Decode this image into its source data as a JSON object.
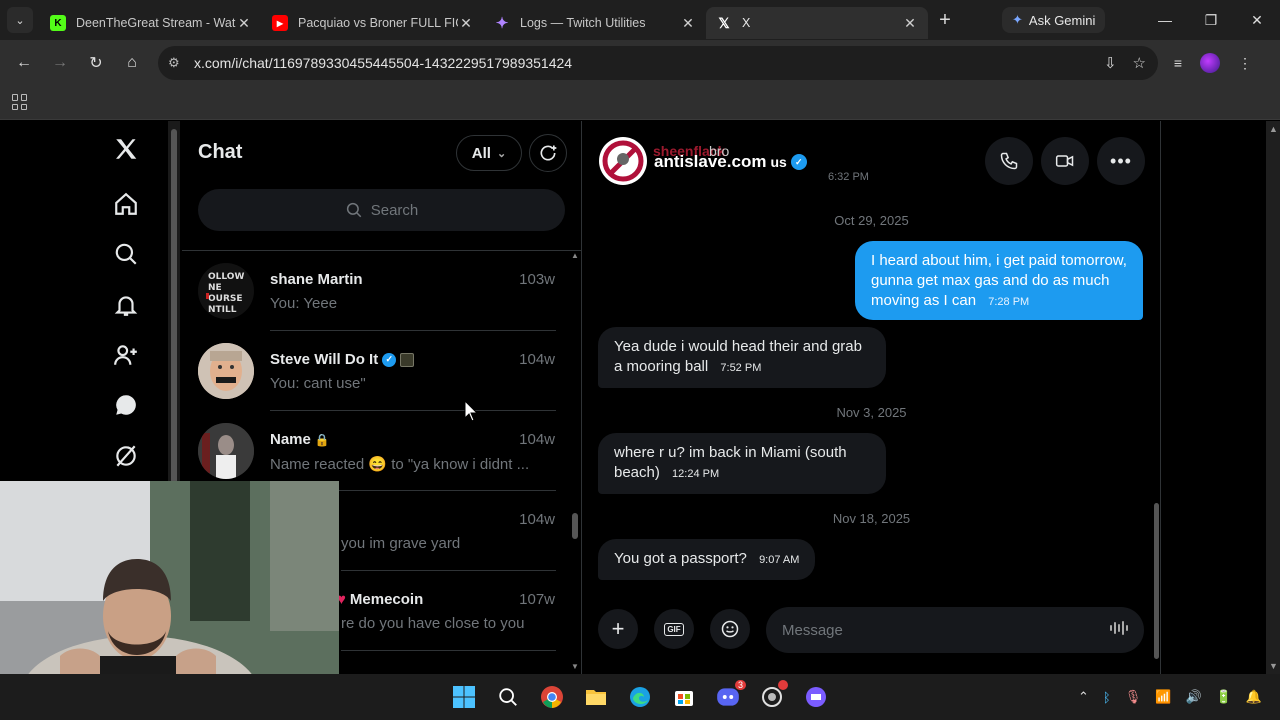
{
  "browser": {
    "tabs": [
      {
        "title": "DeenTheGreat Stream - Wat",
        "favicon": "kick-icon",
        "color": "#53fc18"
      },
      {
        "title": "Pacquiao vs Broner FULL FIG",
        "favicon": "youtube-icon",
        "color": "#ff0000"
      },
      {
        "title": "Logs — Twitch Utilities",
        "favicon": "sparkle-icon",
        "color": "#9146ff"
      },
      {
        "title": "X",
        "favicon": "x-icon",
        "color": "#ffffff"
      }
    ],
    "gemini_label": "Ask Gemini",
    "url": "x.com/i/chat/1169789330455445504-1432229517989351424"
  },
  "chat_list": {
    "title": "Chat",
    "filter_label": "All",
    "search_placeholder": "Search",
    "conversations": [
      {
        "name": "shane Martin",
        "time": "103w",
        "preview": "You: Yeee",
        "verified": false,
        "locked": false
      },
      {
        "name": "Steve Will Do It",
        "time": "104w",
        "preview": "You: cant use\"",
        "verified": true,
        "locked": false
      },
      {
        "name": "Name",
        "time": "104w",
        "preview": "Name reacted 😄 to \"ya know i didnt ...",
        "verified": false,
        "locked": true
      },
      {
        "name": "",
        "time": "104w",
        "preview": "you im grave yard",
        "verified": false,
        "locked": false
      },
      {
        "name": "Memecoin",
        "time": "107w",
        "preview": "re do you have close to you",
        "verified": false,
        "locked": false
      }
    ]
  },
  "conversation": {
    "ghost_text_1": "bro",
    "ghost_time": "6:32 PM",
    "contact_name": "antislave.com",
    "contact_suffix": "us",
    "messages": [
      {
        "date": "Oct 29, 2025"
      },
      {
        "dir": "out",
        "text": "I heard about him, i get paid tomorrow, gunna get max gas and do as much moving as I can",
        "time": "7:28 PM"
      },
      {
        "dir": "in",
        "text": "Yea dude i would head their and grab a mooring ball",
        "time": "7:52 PM"
      },
      {
        "date": "Nov 3, 2025"
      },
      {
        "dir": "in",
        "text": "where r u? im back in Miami (south beach)",
        "time": "12:24 PM"
      },
      {
        "date": "Nov 18, 2025"
      },
      {
        "dir": "in",
        "text": "You got a passport?",
        "time": "9:07 AM"
      }
    ],
    "composer_placeholder": "Message"
  },
  "taskbar": {
    "discord_badge": "3"
  },
  "colors": {
    "accent": "#1d9bf0",
    "bg": "#000000",
    "bubble_in": "#16181c",
    "muted": "#71767b"
  }
}
